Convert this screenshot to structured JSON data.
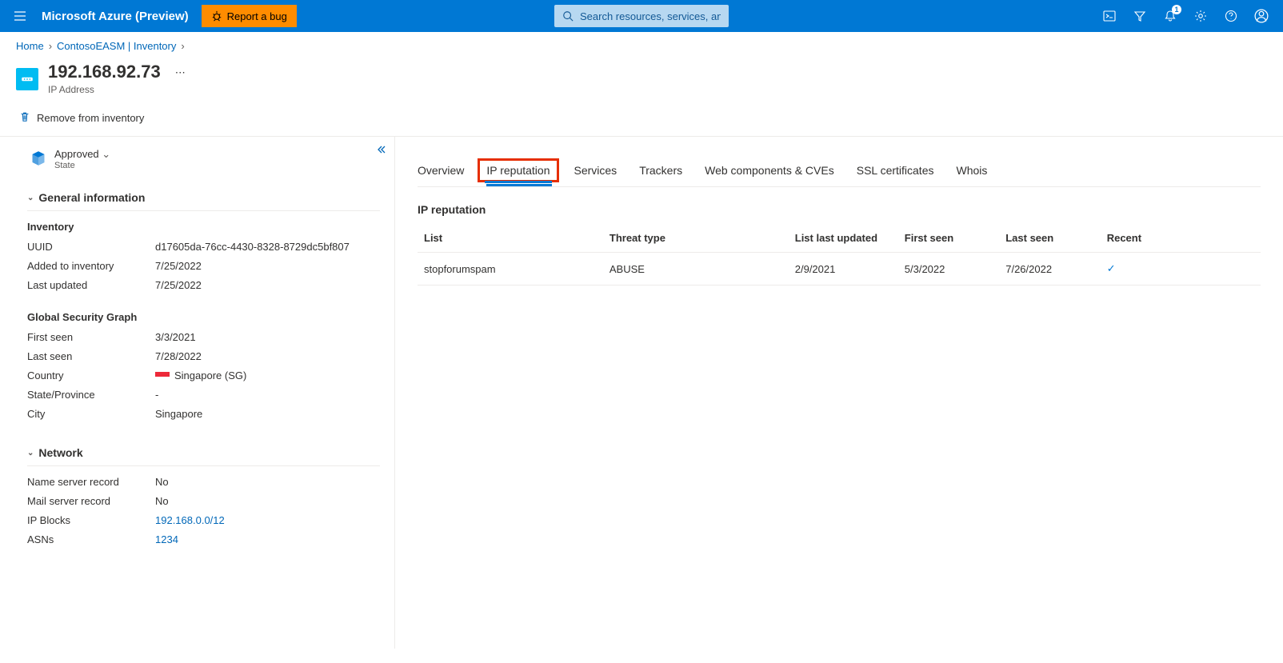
{
  "topbar": {
    "brand": "Microsoft Azure (Preview)",
    "bug_label": "Report a bug",
    "search_placeholder": "Search resources, services, and docs (G+/)",
    "notification_count": "1"
  },
  "breadcrumb": {
    "items": [
      "Home",
      "ContosoEASM | Inventory"
    ]
  },
  "title": {
    "heading": "192.168.92.73",
    "subtitle": "IP Address"
  },
  "actions": {
    "remove": "Remove from inventory"
  },
  "state": {
    "value": "Approved",
    "label": "State"
  },
  "sections": {
    "general": {
      "header": "General information",
      "inventory_header": "Inventory",
      "uuid_label": "UUID",
      "uuid_value": "d17605da-76cc-4430-8328-8729dc5bf807",
      "added_label": "Added to inventory",
      "added_value": "7/25/2022",
      "updated_label": "Last updated",
      "updated_value": "7/25/2022",
      "gsg_header": "Global Security Graph",
      "first_seen_label": "First seen",
      "first_seen_value": "3/3/2021",
      "last_seen_label": "Last seen",
      "last_seen_value": "7/28/2022",
      "country_label": "Country",
      "country_value": "Singapore (SG)",
      "state_label": "State/Province",
      "state_value": "-",
      "city_label": "City",
      "city_value": "Singapore"
    },
    "network": {
      "header": "Network",
      "ns_label": "Name server record",
      "ns_value": "No",
      "mail_label": "Mail server record",
      "mail_value": "No",
      "ipblocks_label": "IP Blocks",
      "ipblocks_value": "192.168.0.0/12",
      "asns_label": "ASNs",
      "asns_value": "1234"
    }
  },
  "tabs": {
    "overview": "Overview",
    "ip_reputation": "IP reputation",
    "services": "Services",
    "trackers": "Trackers",
    "web_components": "Web components & CVEs",
    "ssl": "SSL certificates",
    "whois": "Whois"
  },
  "right": {
    "title": "IP reputation",
    "columns": {
      "list": "List",
      "threat": "Threat type",
      "updated": "List last updated",
      "first_seen": "First seen",
      "last_seen": "Last seen",
      "recent": "Recent"
    },
    "rows": [
      {
        "list": "stopforumspam",
        "threat": "ABUSE",
        "updated": "2/9/2021",
        "first_seen": "5/3/2022",
        "last_seen": "7/26/2022",
        "recent": true
      }
    ]
  }
}
